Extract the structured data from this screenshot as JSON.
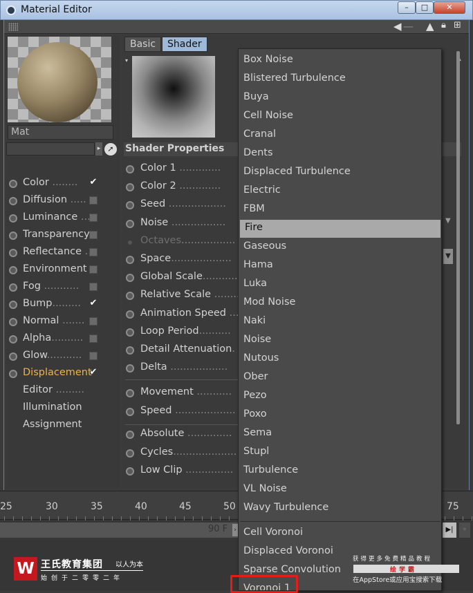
{
  "window": {
    "title": "Material Editor",
    "controls": [
      "–",
      "□",
      "✕"
    ]
  },
  "toolbar": {
    "icons": [
      "back-arrow-icon",
      "cursor-icon",
      "lock-icon",
      "new-window-icon"
    ]
  },
  "material": {
    "name": "Mat",
    "link_value": ""
  },
  "channels": [
    {
      "label": "Color",
      "dots": " ........",
      "state": "checked"
    },
    {
      "label": "Diffusion",
      "dots": " .....",
      "state": "unchecked"
    },
    {
      "label": "Luminance",
      "dots": " ...",
      "state": "unchecked"
    },
    {
      "label": "Transparency",
      "dots": "",
      "state": "unchecked"
    },
    {
      "label": "Reflectance",
      "dots": " ..",
      "state": "unchecked"
    },
    {
      "label": "Environment",
      "dots": "",
      "state": "unchecked"
    },
    {
      "label": "Fog",
      "dots": " ...........",
      "state": "unchecked"
    },
    {
      "label": "Bump",
      "dots": ".........",
      "state": "checked"
    },
    {
      "label": "Normal",
      "dots": " .......",
      "state": "unchecked"
    },
    {
      "label": "Alpha",
      "dots": "..........",
      "state": "unchecked"
    },
    {
      "label": "Glow",
      "dots": "...........",
      "state": "unchecked"
    },
    {
      "label": "Displacement",
      "dots": "",
      "state": "checked",
      "active": true
    },
    {
      "label": "Editor",
      "dots": " .........",
      "state": "none"
    },
    {
      "label": "Illumination",
      "dots": "",
      "state": "none"
    },
    {
      "label": "Assignment",
      "dots": "",
      "state": "none"
    }
  ],
  "tabs": {
    "basic": "Basic",
    "shader": "Shader"
  },
  "shader": {
    "section_title": "Shader Properties",
    "props": [
      {
        "label": "Color 1",
        "dots": " .............",
        "dim": false
      },
      {
        "label": "Color 2",
        "dots": " .............",
        "dim": false
      },
      {
        "label": "Seed",
        "dots": " ..................",
        "dim": false
      },
      {
        "label": "Noise",
        "dots": " .................",
        "dim": false
      },
      {
        "label": "Octaves",
        "dots": ".................",
        "dim": true
      },
      {
        "label": "Space",
        "dots": "...................",
        "dim": false
      },
      {
        "label": "Global Scale",
        "dots": "...........",
        "dim": false
      },
      {
        "label": "Relative Scale",
        "dots": " .........",
        "dim": false
      },
      {
        "label": "Animation Speed",
        "dots": " ....",
        "dim": false
      },
      {
        "label": "Loop Period",
        "dots": "..........",
        "dim": false
      },
      {
        "label": "Detail Attenuation",
        "dots": ".",
        "dim": false
      },
      {
        "label": "Delta",
        "dots": " ..................",
        "dim": false
      }
    ],
    "props2": [
      {
        "label": "Movement",
        "dots": " ...........",
        "dim": false
      },
      {
        "label": "Speed",
        "dots": " ...................",
        "dim": false
      }
    ],
    "props3": [
      {
        "label": "Absolute",
        "dots": " ..............",
        "dim": false
      },
      {
        "label": "Cycles",
        "dots": "....................",
        "dim": false
      },
      {
        "label": "Low Clip",
        "dots": " ...............",
        "dim": false
      }
    ]
  },
  "dropdown": {
    "selected": "Fire",
    "group1": [
      "Box Noise",
      "Blistered Turbulence",
      "Buya",
      "Cell Noise",
      "Cranal",
      "Dents",
      "Displaced Turbulence",
      "Electric",
      "FBM",
      "Fire",
      "Gaseous",
      "Hama",
      "Luka",
      "Mod Noise",
      "Naki",
      "Noise",
      "Nutous",
      "Ober",
      "Pezo",
      "Poxo",
      "Sema",
      "Stupl",
      "Turbulence",
      "VL Noise",
      "Wavy Turbulence"
    ],
    "group2": [
      "Cell Voronoi",
      "Displaced Voronoi",
      "Sparse Convolution",
      "Voronoi 1"
    ]
  },
  "timeline": {
    "ticks": [
      "25",
      "30",
      "35",
      "40",
      "45",
      "50",
      "75"
    ],
    "frame_label": "90 F",
    "play_icon": "▶|",
    "next_icon": "›"
  },
  "watermark": {
    "logo_letter": "W",
    "company": "王氏教育集团",
    "slogan": "以人为本",
    "sub": "始创于二零零二年",
    "promo_line1": "获得更多免费精品教程",
    "promo_brand": "绘学霸",
    "promo_line2": "在AppStore或应用宝搜索下载"
  },
  "colors": {
    "active_channel": "#ebb44a",
    "selected_tab": "#9eb8d8",
    "selected_item": "#a9a9a9",
    "highlight_box": "#e51c1c"
  }
}
